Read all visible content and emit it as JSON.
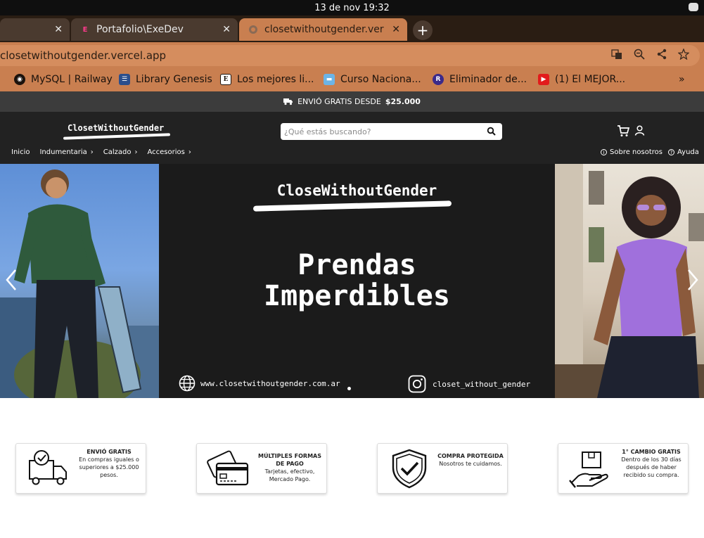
{
  "system": {
    "clock": "13 de nov  19:32"
  },
  "tabs": [
    {
      "label": "",
      "active": false
    },
    {
      "label": "Portafolio\\ExeDev",
      "active": false
    },
    {
      "label": "closetwithoutgender.ver",
      "active": true
    }
  ],
  "omnibox": {
    "url": "closetwithoutgender.vercel.app"
  },
  "bookmarks": [
    {
      "label": "MySQL | Railway",
      "icon": "railway-icon"
    },
    {
      "label": "Library Genesis",
      "icon": "library-icon"
    },
    {
      "label": "Los mejores li...",
      "icon": "e-icon"
    },
    {
      "label": "Curso Naciona...",
      "icon": "flag-icon"
    },
    {
      "label": "Eliminador de...",
      "icon": "r-icon"
    },
    {
      "label": "(1) El MEJOR...",
      "icon": "youtube-icon"
    }
  ],
  "bookmarks_overflow": "»",
  "site": {
    "shipping": {
      "text": "ENVIÓ GRATIS DESDE",
      "amount": "$25.000"
    },
    "logo": "ClosetWithoutGender",
    "search_placeholder": "¿Qué estás buscando?",
    "nav": [
      "Inicio",
      "Indumentaria",
      "Calzado",
      "Accesorios"
    ],
    "about": "Sobre nosotros",
    "help": "Ayuda",
    "hero": {
      "brand": "CloseWithoutGender",
      "headline_1": "Prendas",
      "headline_2": "Imperdibles",
      "website": "www.closetwithoutgender.com.ar",
      "instagram": "closet_without_gender"
    },
    "features": [
      {
        "title": "ENVIÓ GRATIS",
        "desc": "En compras iguales o superiores a $25.000 pesos."
      },
      {
        "title": "MÚLTIPLES FORMAS DE PAGO",
        "desc": "Tarjetas, efectivo, Mercado Pago."
      },
      {
        "title": "COMPRA PROTEGIDA",
        "desc": "Nosotros te cuidamos."
      },
      {
        "title": "1° CAMBIO GRATIS",
        "desc": "Dentro de los 30 días después de haber recibido su compra."
      }
    ]
  },
  "colors": {
    "browser_accent": "#c97f50",
    "header_bg": "#222222",
    "ship_bar": "#3c3c3c"
  }
}
